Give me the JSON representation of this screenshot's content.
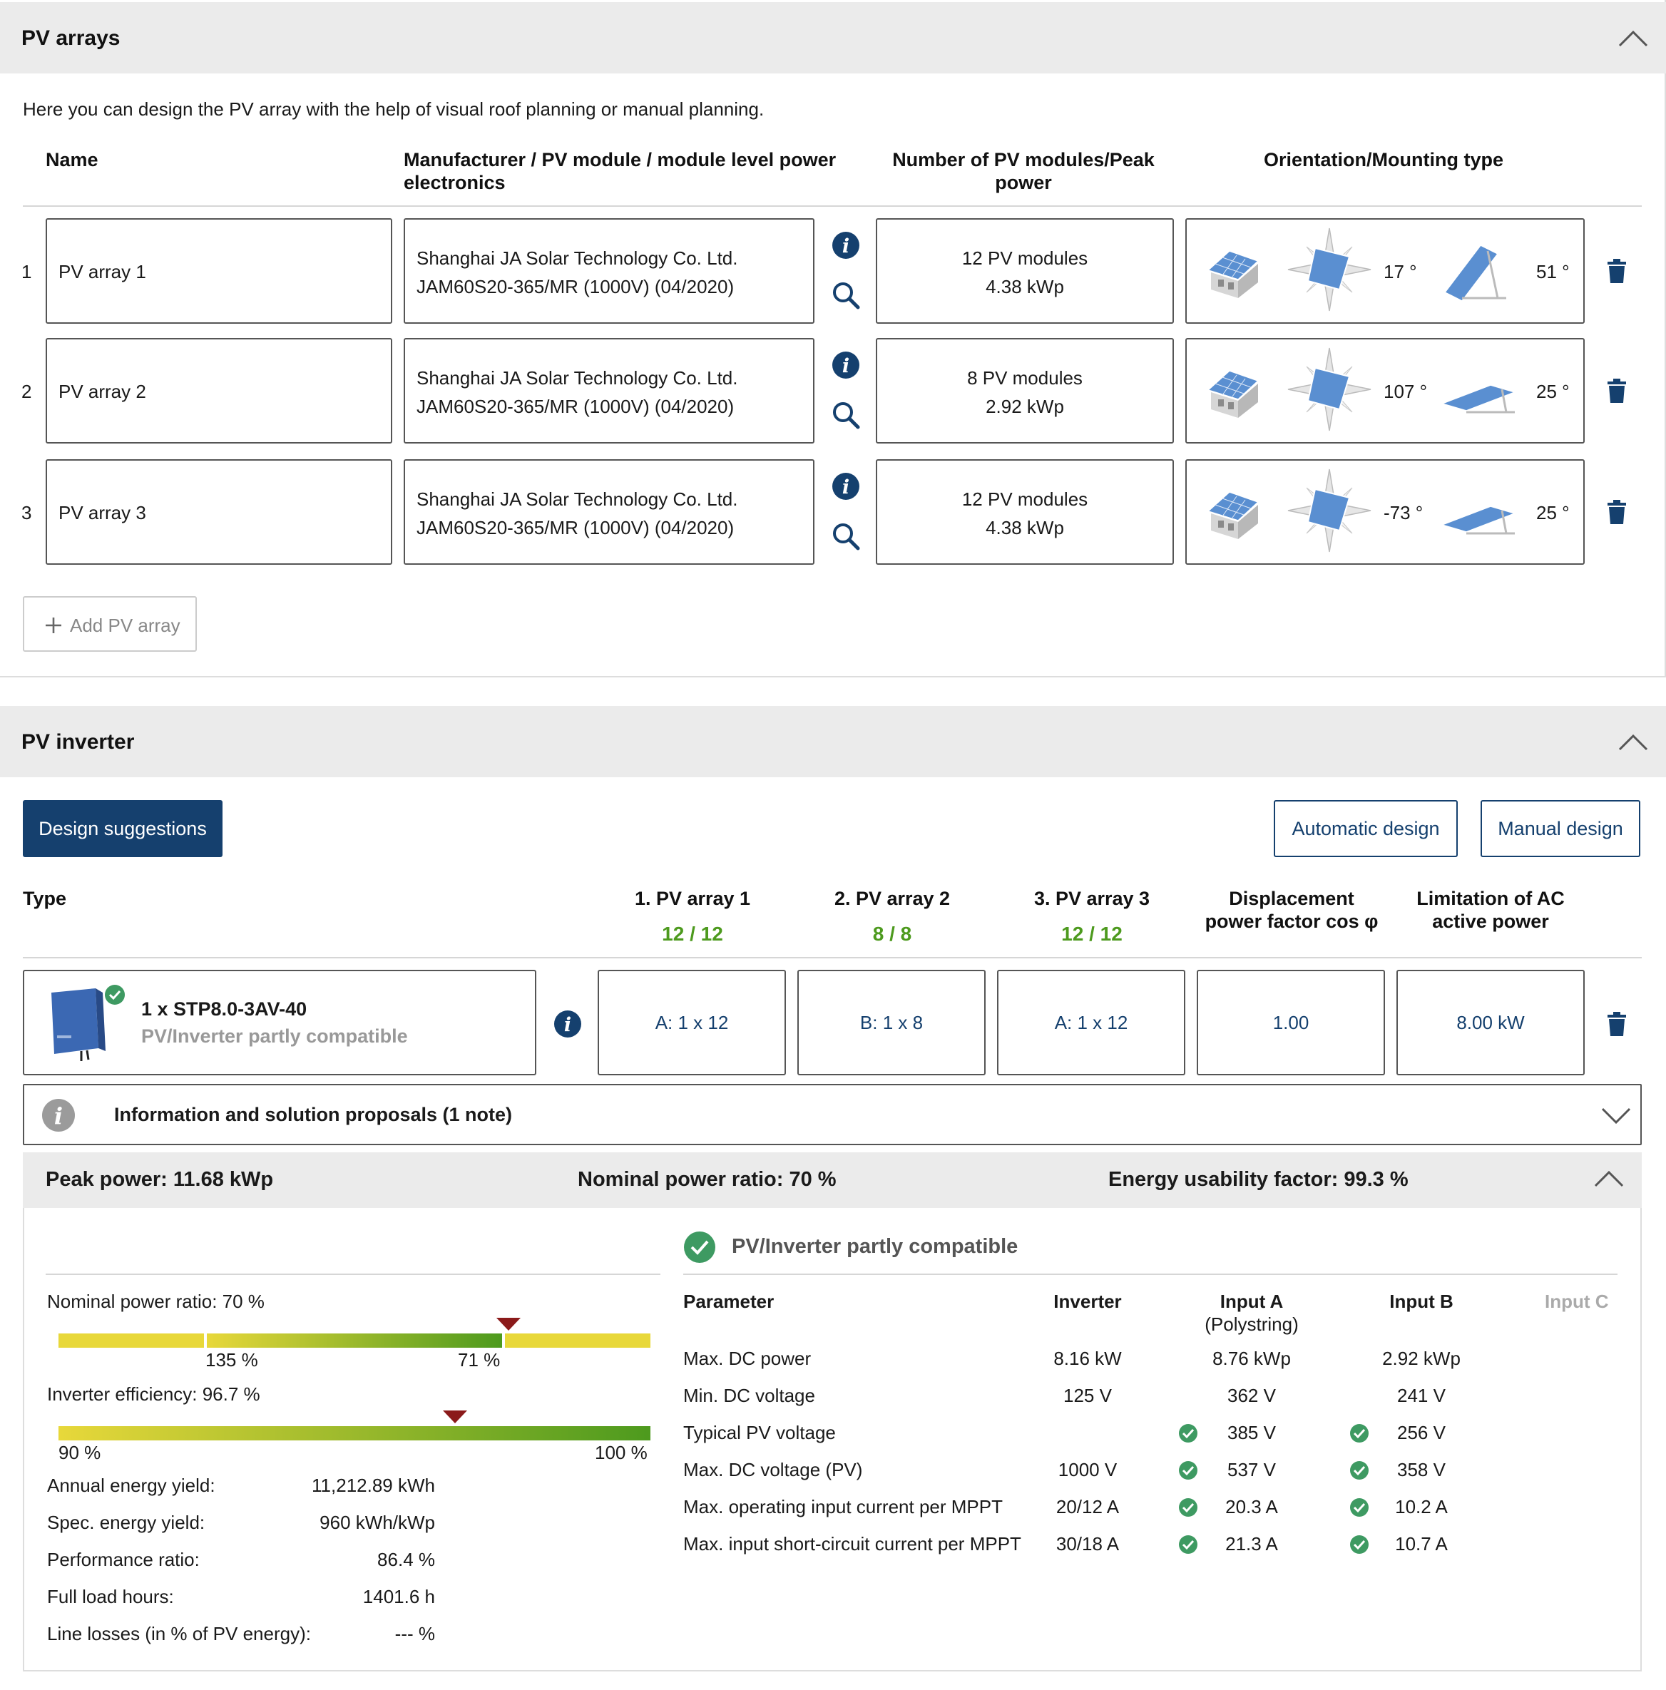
{
  "pv_arrays": {
    "title": "PV arrays",
    "intro": "Here you can design the PV array with the help of visual roof planning or manual planning.",
    "columns": {
      "name": "Name",
      "module": "Manufacturer / PV module / module level power electronics",
      "count": "Number of PV modules/Peak power",
      "orientation": "Orientation/Mounting type"
    },
    "rows": [
      {
        "num": "1",
        "name": "PV array 1",
        "manufacturer": "Shanghai JA Solar Technology Co. Ltd.",
        "module": "JAM60S20-365/MR (1000V) (04/2020)",
        "modules": "12 PV modules",
        "power": "4.38 kWp",
        "azimuth": "17 °",
        "tilt": "51 °"
      },
      {
        "num": "2",
        "name": "PV array 2",
        "manufacturer": "Shanghai JA Solar Technology Co. Ltd.",
        "module": "JAM60S20-365/MR (1000V) (04/2020)",
        "modules": "8 PV modules",
        "power": "2.92 kWp",
        "azimuth": "107 °",
        "tilt": "25 °"
      },
      {
        "num": "3",
        "name": "PV array 3",
        "manufacturer": "Shanghai JA Solar Technology Co. Ltd.",
        "module": "JAM60S20-365/MR (1000V) (04/2020)",
        "modules": "12 PV modules",
        "power": "4.38 kWp",
        "azimuth": "-73 °",
        "tilt": "25 °"
      }
    ],
    "add_label": "Add PV array"
  },
  "pv_inverter": {
    "title": "PV inverter",
    "design_suggestions": "Design suggestions",
    "automatic_design": "Automatic design",
    "manual_design": "Manual design",
    "cols": {
      "type": "Type",
      "a1": "1. PV array 1",
      "a1_count": "12 / 12",
      "a2": "2. PV array 2",
      "a2_count": "8 / 8",
      "a3": "3. PV array 3",
      "a3_count": "12 / 12",
      "disp_l1": "Displacement",
      "disp_l2": "power factor cos φ",
      "lim_l1": "Limitation of AC",
      "lim_l2": "active power"
    },
    "inverter": {
      "model": "1 x STP8.0-3AV-40",
      "status": "PV/Inverter partly compatible",
      "a1": "A: 1 x 12",
      "a2": "B: 1 x 8",
      "a3": "A: 1 x 12",
      "cos": "1.00",
      "limit": "8.00 kW"
    },
    "info_bar": "Information and solution proposals (1 note)",
    "summary": {
      "peak": "Peak power: 11.68 kWp",
      "ratio": "Nominal power ratio: 70 %",
      "usability": "Energy usability factor: 99.3 %"
    },
    "gauges": {
      "nominal_label": "Nominal power ratio: 70 %",
      "nominal_left": "135 %",
      "nominal_right": "71 %",
      "nominal_marker": 0.76,
      "eff_label": "Inverter efficiency: 96.7 %",
      "eff_left": "90 %",
      "eff_right": "100 %",
      "eff_marker": 0.67
    },
    "stats": [
      {
        "label": "Annual energy yield:",
        "value": "11,212.89 kWh"
      },
      {
        "label": "Spec. energy yield:",
        "value": "960 kWh/kWp"
      },
      {
        "label": "Performance ratio:",
        "value": "86.4 %"
      },
      {
        "label": "Full load hours:",
        "value": "1401.6 h"
      },
      {
        "label": "Line losses (in % of PV energy):",
        "value": "--- %"
      }
    ],
    "compat_title": "PV/Inverter partly compatible",
    "params": {
      "h_param": "Parameter",
      "h_inv": "Inverter",
      "h_a": "Input A",
      "h_a_sub": "(Polystring)",
      "h_b": "Input B",
      "h_c": "Input C",
      "rows": [
        {
          "p": "Max. DC power",
          "inv": "8.16 kW",
          "a": "8.76 kWp",
          "b": "2.92 kWp",
          "ok": false
        },
        {
          "p": "Min. DC voltage",
          "inv": "125 V",
          "a": "362 V",
          "b": "241 V",
          "ok": false
        },
        {
          "p": "Typical PV voltage",
          "inv": "",
          "a": "385 V",
          "b": "256 V",
          "ok": true
        },
        {
          "p": "Max. DC voltage (PV)",
          "inv": "1000 V",
          "a": "537 V",
          "b": "358 V",
          "ok": true
        },
        {
          "p": "Max. operating input current per MPPT",
          "inv": "20/12 A",
          "a": "20.3 A",
          "b": "10.2 A",
          "ok": true
        },
        {
          "p": "Max. input short-circuit current per MPPT",
          "inv": "30/18 A",
          "a": "21.3 A",
          "b": "10.7 A",
          "ok": true
        }
      ]
    }
  },
  "colors": {
    "brand": "#15406e",
    "ok": "#3e9a62",
    "green": "#4d9a1e",
    "marker": "#8b1a1a"
  }
}
